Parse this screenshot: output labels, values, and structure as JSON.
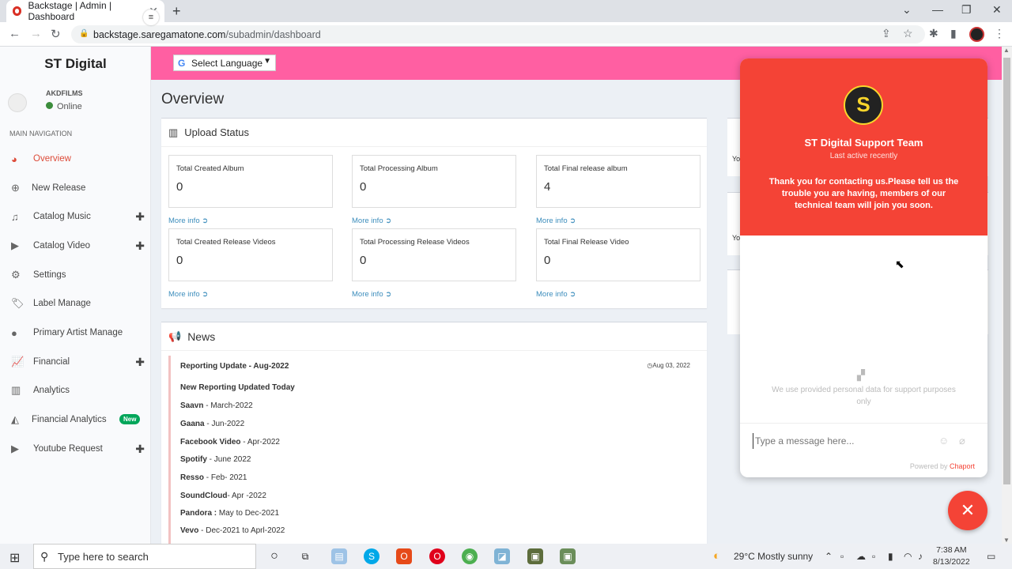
{
  "browser": {
    "tab_title": "Backstage | Admin | Dashboard",
    "url_domain": "backstage.saregamatone.com",
    "url_path": "/subadmin/dashboard"
  },
  "sidebar": {
    "brand": "ST Digital",
    "user_name": "AKDFILMS",
    "user_status": "Online",
    "section_label": "MAIN NAVIGATION",
    "items": [
      {
        "label": "Overview",
        "icon": "dashboard-icon"
      },
      {
        "label": "New Release",
        "icon": "plus-circle-icon"
      },
      {
        "label": "Catalog Music",
        "icon": "music-icon"
      },
      {
        "label": "Catalog Video",
        "icon": "play-circle-icon"
      },
      {
        "label": "Settings",
        "icon": "gear-icon"
      },
      {
        "label": "Label Manage",
        "icon": "tag-icon"
      },
      {
        "label": "Primary Artist Manage",
        "icon": "user-icon"
      },
      {
        "label": "Financial",
        "icon": "line-chart-icon"
      },
      {
        "label": "Analytics",
        "icon": "bar-chart-icon"
      },
      {
        "label": "Financial Analytics",
        "icon": "area-chart-icon",
        "badge": "New"
      },
      {
        "label": "Youtube Request",
        "icon": "play-circle-icon"
      }
    ]
  },
  "header": {
    "language_select": "Select Language"
  },
  "overview": {
    "title": "Overview",
    "upload_status_title": "Upload Status",
    "more_info": "More info",
    "stats": [
      {
        "label": "Total Created Album",
        "value": "0"
      },
      {
        "label": "Total Processing Album",
        "value": "0"
      },
      {
        "label": "Total Final release album",
        "value": "4"
      },
      {
        "label": "Total Created Release Videos",
        "value": "0"
      },
      {
        "label": "Total Processing Release Videos",
        "value": "0"
      },
      {
        "label": "Total Final Release Video",
        "value": "0"
      }
    ]
  },
  "news": {
    "title": "News",
    "item_title": "Reporting Update - Aug-2022",
    "item_date": "Aug 03, 2022",
    "subtitle": "New Reporting Updated Today",
    "lines": [
      {
        "name": "Saavn",
        "sep": " - ",
        "period": "March-2022"
      },
      {
        "name": "Gaana",
        "sep": " - ",
        "period": "Jun-2022"
      },
      {
        "name": "Facebook Video",
        "sep": " - ",
        "period": "Apr-2022"
      },
      {
        "name": "Spotify",
        "sep": " - ",
        "period": "June 2022"
      },
      {
        "name": "Resso",
        "sep": " - ",
        "period": "Feb- 2021"
      },
      {
        "name": "SoundCloud",
        "sep": "- ",
        "period": "Apr -2022"
      },
      {
        "name": "Pandora :",
        "sep": " ",
        "period": "May to Dec-2021"
      },
      {
        "name": "Vevo",
        "sep": " -  ",
        "period": "Dec-2021 to Aprl-2022"
      }
    ]
  },
  "right_boxes": {
    "box1_text": "Yo",
    "box2_text": "Yo"
  },
  "chat": {
    "team_name": "ST Digital Support Team",
    "activity": "Last active recently",
    "message": "Thank you for contacting us.Please tell us the trouble you are having, members of our technical team will join you soon.",
    "privacy": "We use provided personal data for support purposes only",
    "input_placeholder": "Type a message here...",
    "powered_prefix": "Powered by",
    "powered_brand": "Chaport"
  },
  "taskbar": {
    "search_placeholder": "Type here to search",
    "weather": "29°C  Mostly sunny",
    "time": "7:38 AM",
    "date": "8/13/2022"
  },
  "colors": {
    "header_pink": "#ff5fa2",
    "chat_red": "#f44336",
    "active_nav": "#dd4b39",
    "link_blue": "#3c8dbc",
    "badge_green": "#00a65a"
  }
}
